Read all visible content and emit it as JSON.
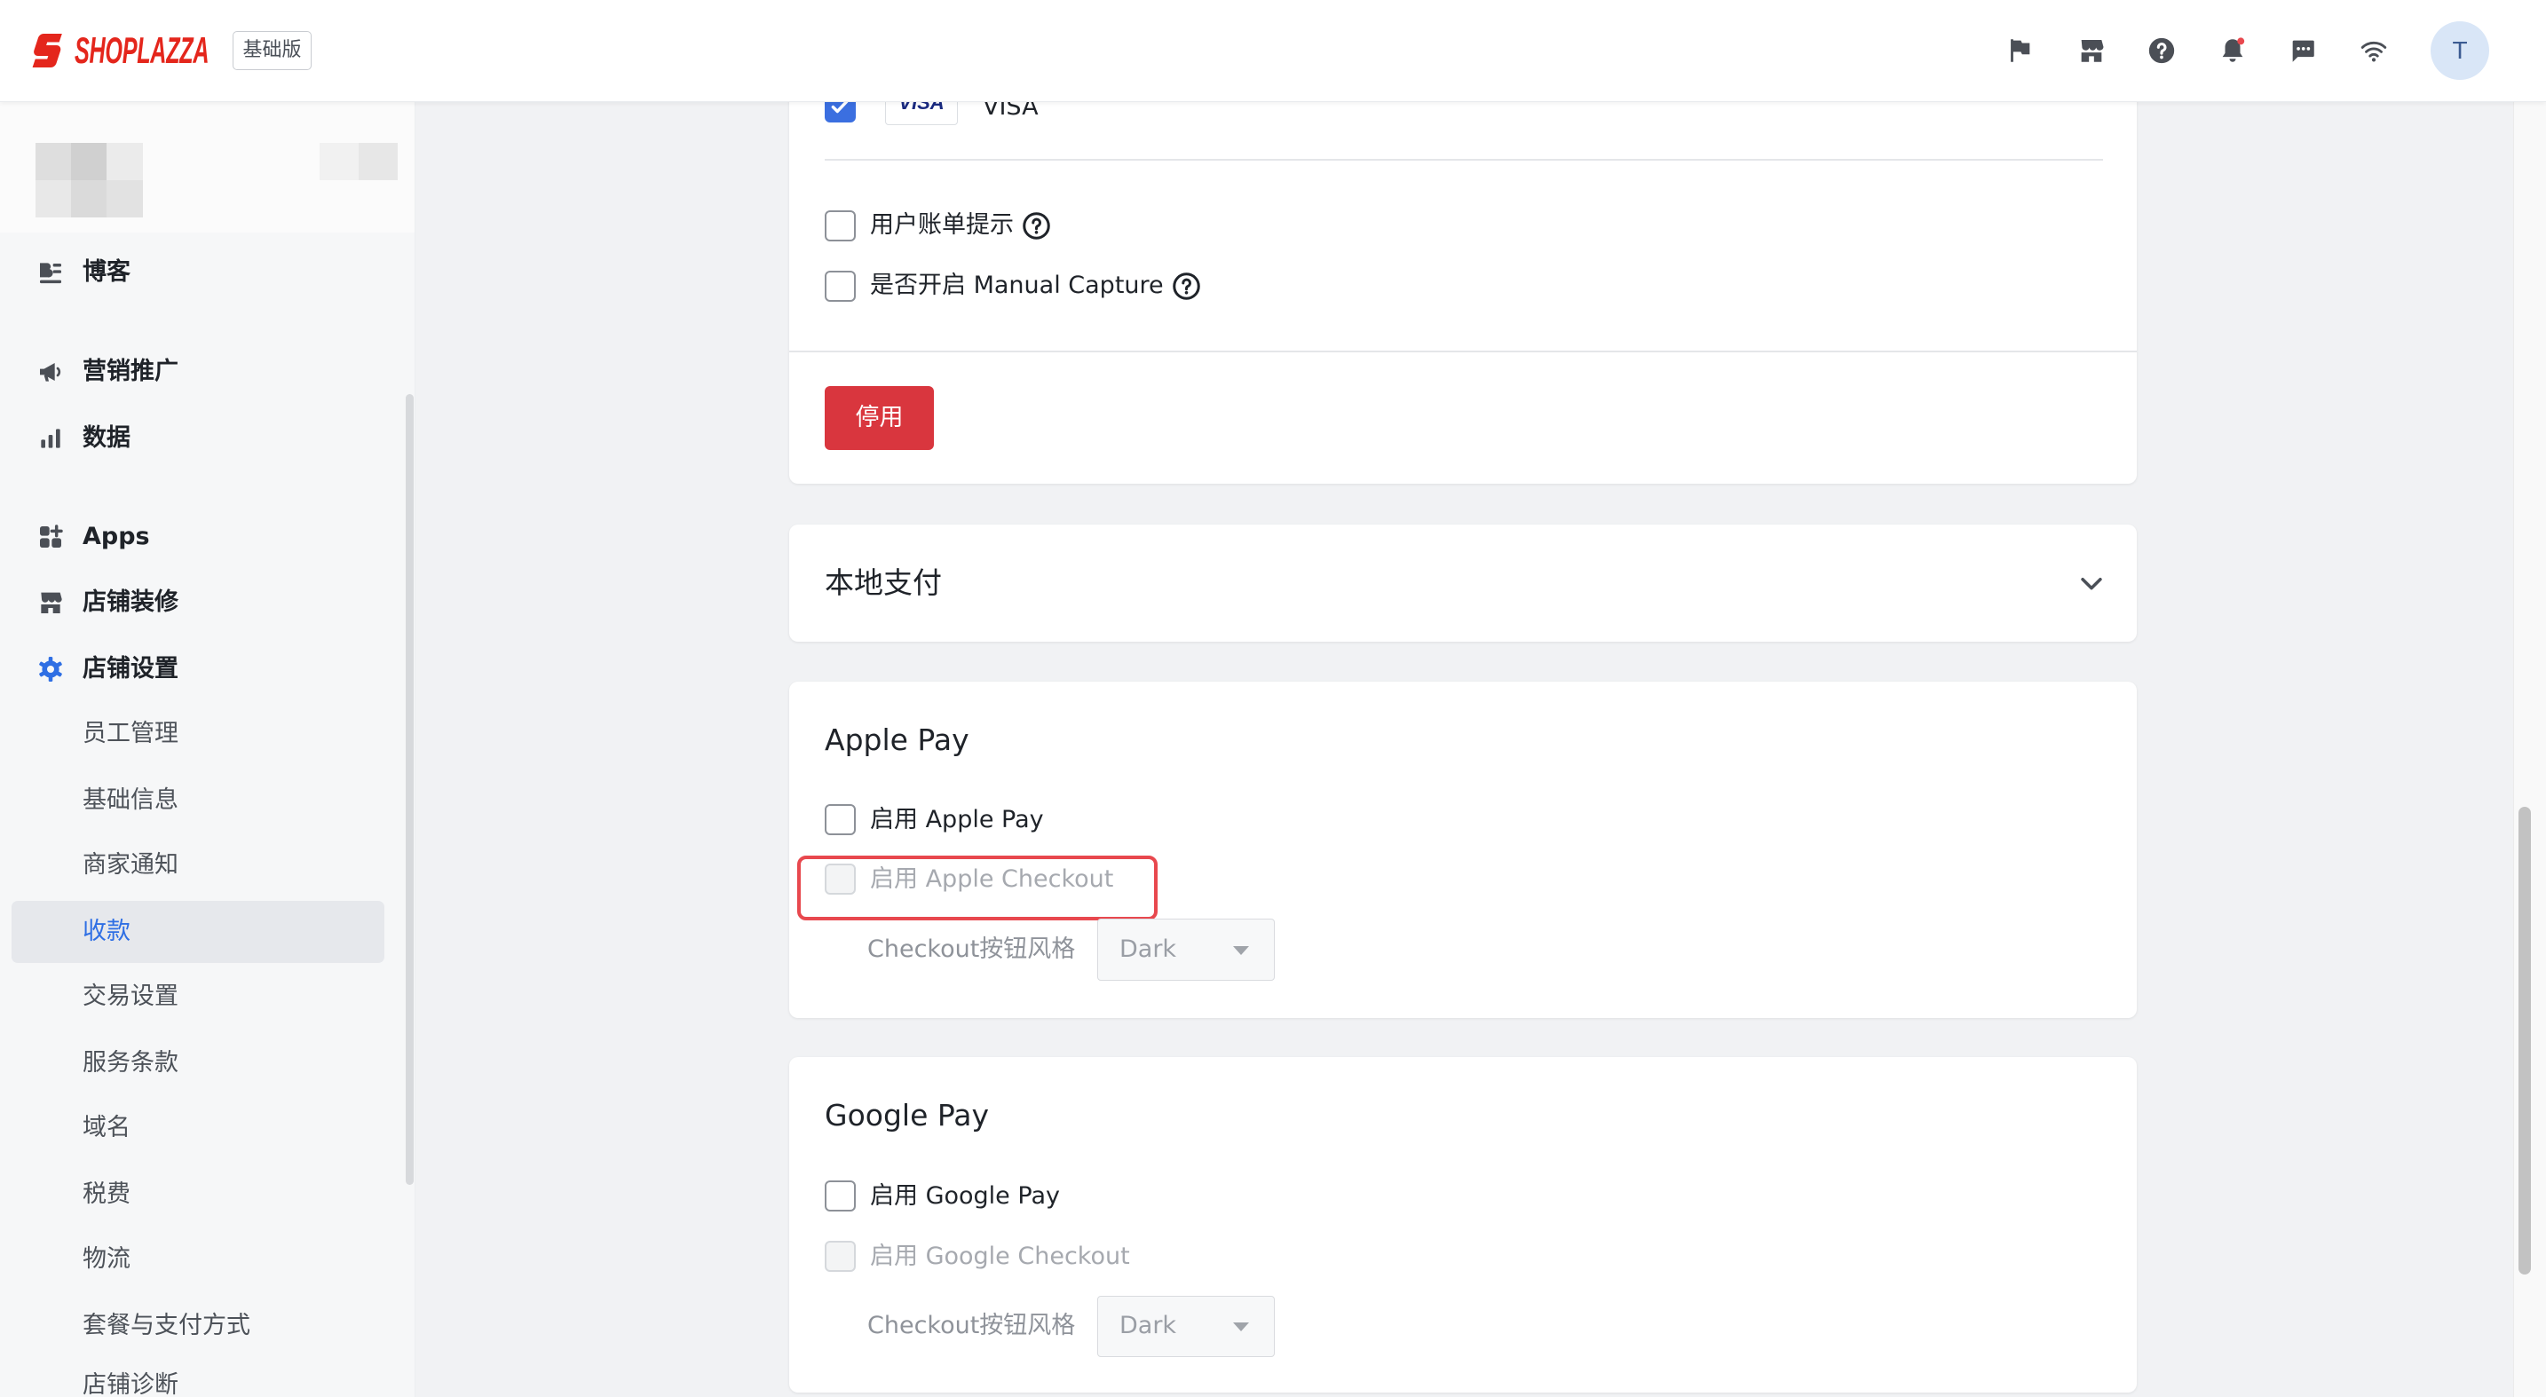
{
  "header": {
    "brand": "SHOPLAZZA",
    "plan_badge": "基础版",
    "avatar_initial": "T",
    "actions": [
      {
        "icon": "flag-icon"
      },
      {
        "icon": "store-icon"
      },
      {
        "icon": "help-icon"
      },
      {
        "icon": "bell-icon",
        "has_notification": true
      },
      {
        "icon": "chat-icon"
      },
      {
        "icon": "wifi-icon"
      }
    ]
  },
  "sidebar": {
    "items": [
      {
        "label": "博客",
        "icon": "blog-icon"
      },
      {
        "label": "营销推广",
        "icon": "megaphone-icon"
      },
      {
        "label": "数据",
        "icon": "bar-chart-icon"
      },
      {
        "label": "Apps",
        "icon": "apps-icon"
      },
      {
        "label": "店铺装修",
        "icon": "storefront-icon"
      },
      {
        "label": "店铺设置",
        "icon": "gear-icon",
        "expanded": true
      }
    ],
    "settings_subitems": [
      {
        "label": "员工管理"
      },
      {
        "label": "基础信息"
      },
      {
        "label": "商家通知"
      },
      {
        "label": "收款",
        "active": true
      },
      {
        "label": "交易设置"
      },
      {
        "label": "服务条款"
      },
      {
        "label": "域名"
      },
      {
        "label": "税费"
      },
      {
        "label": "物流"
      },
      {
        "label": "套餐与支付方式"
      },
      {
        "label": "店铺诊断"
      }
    ]
  },
  "card_gateway": {
    "visa": {
      "checked": true,
      "logo_text": "VISA",
      "label": "VISA"
    },
    "options": [
      {
        "label": "用户账单提示",
        "checked": false,
        "icon": "help-circle-icon"
      },
      {
        "label": "是否开启 Manual Capture",
        "checked": false,
        "icon": "help-circle-icon"
      }
    ],
    "disable_button": "停用"
  },
  "local_payment": {
    "title": "本地支付",
    "expanded": false,
    "icon": "chevron-down-icon"
  },
  "apple_pay": {
    "title": "Apple Pay",
    "enable": {
      "label": "启用 Apple Pay",
      "checked": false
    },
    "checkout": {
      "label": "启用 Apple Checkout",
      "checked": false,
      "disabled": true
    },
    "button_style": {
      "label": "Checkout按钮风格",
      "value": "Dark",
      "disabled": true
    }
  },
  "google_pay": {
    "title": "Google Pay",
    "enable": {
      "label": "启用 Google Pay",
      "checked": false
    },
    "checkout": {
      "label": "启用 Google Checkout",
      "checked": false,
      "disabled": true
    },
    "button_style": {
      "label": "Checkout按钮风格",
      "value": "Dark",
      "disabled": true
    }
  },
  "colors": {
    "brand": "#e4261c",
    "accent": "#2f6fe4",
    "danger_button": "#d9363e",
    "highlight_outline": "#e8484e",
    "notification_dot": "#e8484e"
  }
}
